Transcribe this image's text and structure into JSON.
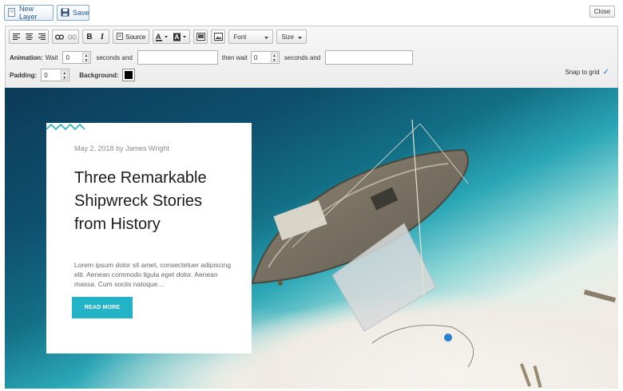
{
  "top": {
    "new_layer_label": "New Layer",
    "save_label": "Save",
    "close_label": "Close"
  },
  "toolbar": {
    "source_label": "Source",
    "font_label": "Font",
    "size_label": "Size",
    "animation_label": "Animation:",
    "wait_label": "Wait",
    "wait_value": "0",
    "seconds_and_1": "seconds and",
    "then_wait_label": "then wait",
    "then_wait_value": "0",
    "seconds_and_2": "seconds and",
    "padding_label": "Padding:",
    "padding_value": "0",
    "background_label": "Background:",
    "background_color": "#000000",
    "snap_label": "Snap to grid",
    "snap_checked": true
  },
  "card": {
    "meta": "May 2, 2018 by James Wright",
    "headline": "Three Remarkable Shipwreck Stories from History",
    "excerpt": "Lorem ipsum dolor sit amet, consectetuer adipiscing elit. Aenean commodo ligula eget dolor. Aenean massa. Cum sociis natoque…",
    "button_label": "READ MORE",
    "accent_color": "#23b3c7"
  },
  "icons": {
    "new_layer": "page-icon",
    "save": "floppy-disk-icon",
    "align_left": "align-left-icon",
    "align_center": "align-center-icon",
    "align_right": "align-right-icon",
    "link": "link-icon",
    "unlink": "unlink-icon",
    "bold": "bold-icon",
    "italic": "italic-icon",
    "source": "source-icon",
    "text_color": "text-color-icon",
    "bg_color": "background-color-icon",
    "image_a": "image-icon",
    "image_b": "picture-icon",
    "snap_check": "check-icon"
  }
}
